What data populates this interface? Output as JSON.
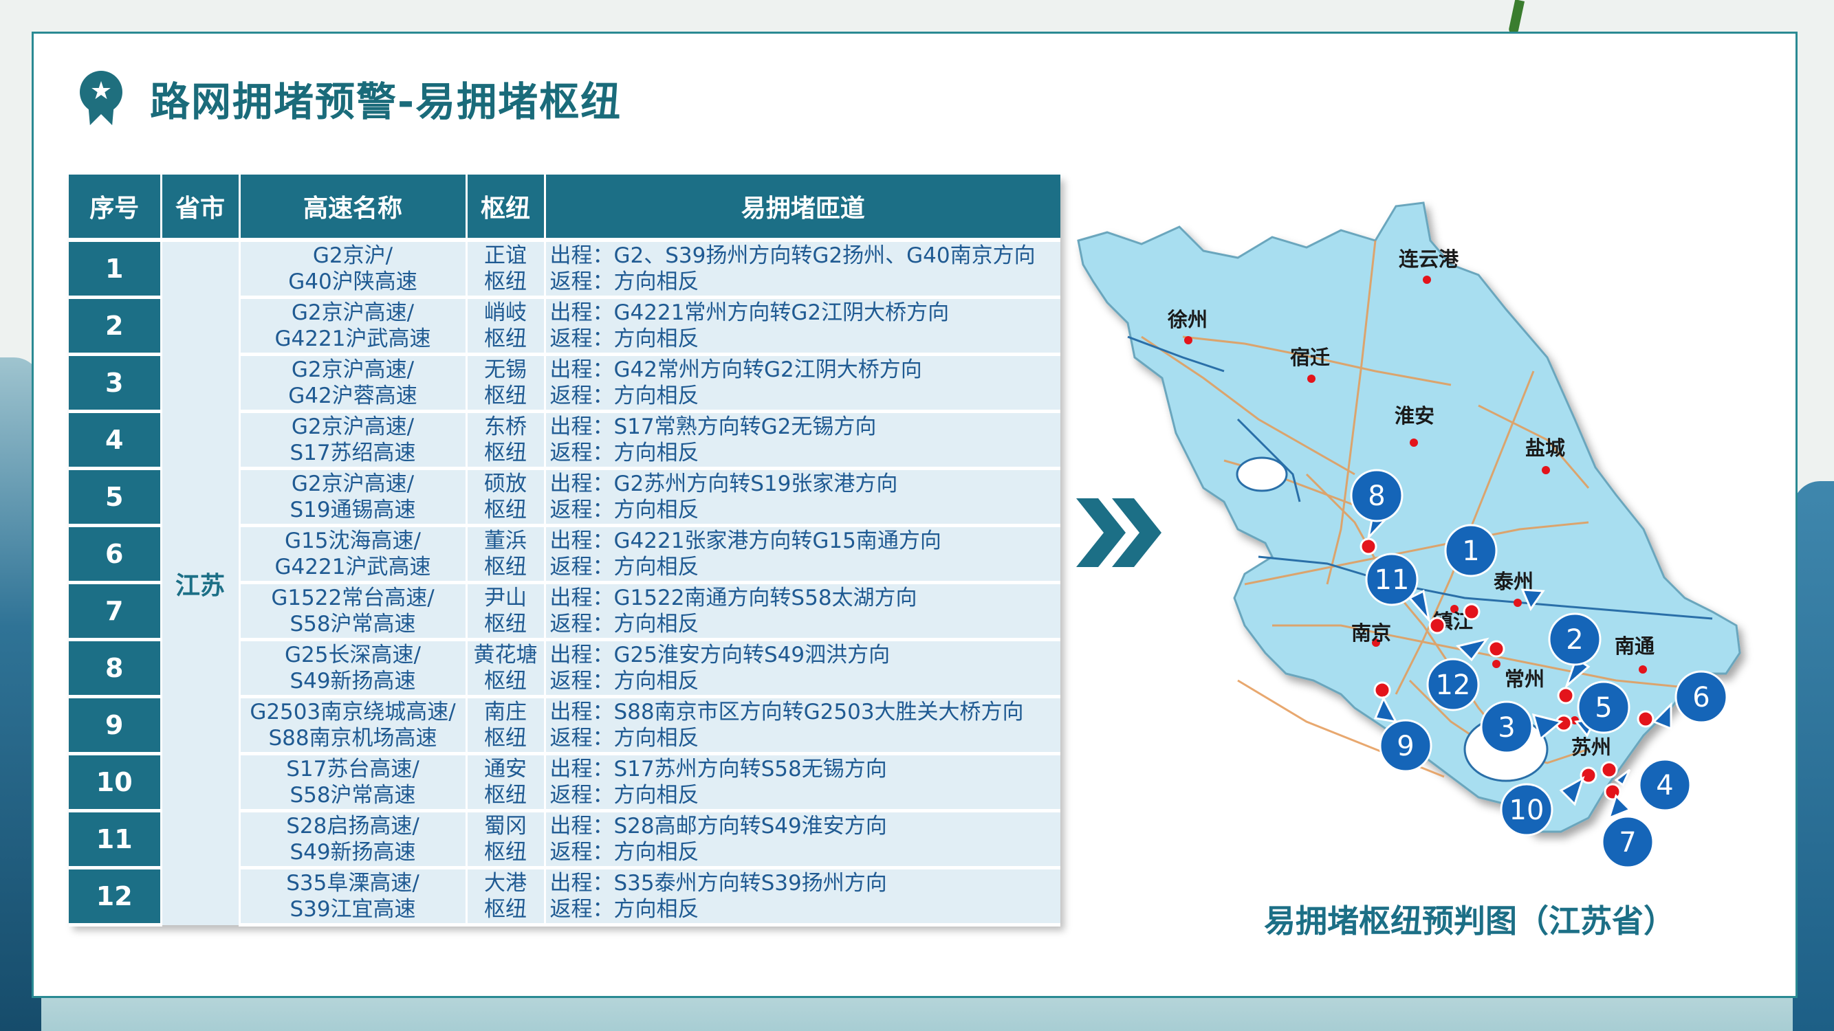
{
  "title": "路网拥堵预警-易拥堵枢纽",
  "table": {
    "headers": [
      "序号",
      "省市",
      "高速名称",
      "枢纽",
      "易拥堵匝道"
    ],
    "province": "江苏",
    "rows": [
      {
        "seq": "1",
        "hw1": "G2京沪/",
        "hw2": "G40沪陕高速",
        "hub1": "正谊",
        "hub2": "枢纽",
        "out": "出程：G2、S39扬州方向转G2扬州、G40南京方向",
        "back": "返程：方向相反"
      },
      {
        "seq": "2",
        "hw1": "G2京沪高速/",
        "hw2": "G4221沪武高速",
        "hub1": "峭岐",
        "hub2": "枢纽",
        "out": "出程：G4221常州方向转G2江阴大桥方向",
        "back": "返程：方向相反"
      },
      {
        "seq": "3",
        "hw1": "G2京沪高速/",
        "hw2": "G42沪蓉高速",
        "hub1": "无锡",
        "hub2": "枢纽",
        "out": "出程：G42常州方向转G2江阴大桥方向",
        "back": "返程：方向相反"
      },
      {
        "seq": "4",
        "hw1": "G2京沪高速/",
        "hw2": "S17苏绍高速",
        "hub1": "东桥",
        "hub2": "枢纽",
        "out": "出程：S17常熟方向转G2无锡方向",
        "back": "返程：方向相反"
      },
      {
        "seq": "5",
        "hw1": "G2京沪高速/",
        "hw2": "S19通锡高速",
        "hub1": "硕放",
        "hub2": "枢纽",
        "out": "出程：G2苏州方向转S19张家港方向",
        "back": "返程：方向相反"
      },
      {
        "seq": "6",
        "hw1": "G15沈海高速/",
        "hw2": "G4221沪武高速",
        "hub1": "董浜",
        "hub2": "枢纽",
        "out": "出程：G4221张家港方向转G15南通方向",
        "back": "返程：方向相反"
      },
      {
        "seq": "7",
        "hw1": "G1522常台高速/",
        "hw2": "S58沪常高速",
        "hub1": "尹山",
        "hub2": "枢纽",
        "out": "出程：G1522南通方向转S58太湖方向",
        "back": "返程：方向相反"
      },
      {
        "seq": "8",
        "hw1": "G25长深高速/",
        "hw2": "S49新扬高速",
        "hub1": "黄花塘",
        "hub2": "枢纽",
        "out": "出程：G25淮安方向转S49泗洪方向",
        "back": "返程：方向相反"
      },
      {
        "seq": "9",
        "hw1": "G2503南京绕城高速/",
        "hw2": "S88南京机场高速",
        "hub1": "南庄",
        "hub2": "枢纽",
        "out": "出程：S88南京市区方向转G2503大胜关大桥方向",
        "back": "返程：方向相反"
      },
      {
        "seq": "10",
        "hw1": "S17苏台高速/",
        "hw2": "S58沪常高速",
        "hub1": "通安",
        "hub2": "枢纽",
        "out": "出程：S17苏州方向转S58无锡方向",
        "back": "返程：方向相反"
      },
      {
        "seq": "11",
        "hw1": "S28启扬高速/",
        "hw2": "S49新扬高速",
        "hub1": "蜀冈",
        "hub2": "枢纽",
        "out": "出程：S28高邮方向转S49淮安方向",
        "back": "返程：方向相反"
      },
      {
        "seq": "12",
        "hw1": "S35阜溧高速/",
        "hw2": "S39江宜高速",
        "hub1": "大港",
        "hub2": "枢纽",
        "out": "出程：S35泰州方向转S39扬州方向",
        "back": "返程：方向相反"
      }
    ]
  },
  "map": {
    "caption": "易拥堵枢纽预判图（江苏省）",
    "cities": [
      "连云港",
      "徐州",
      "宿迁",
      "淮安",
      "盐城",
      "泰州",
      "镇江",
      "南京",
      "常州",
      "南通",
      "苏州"
    ],
    "markers": [
      "1",
      "2",
      "3",
      "4",
      "5",
      "6",
      "7",
      "8",
      "9",
      "10",
      "11",
      "12"
    ]
  },
  "colors": {
    "accent": "#1c6f86",
    "row_bg": "#e1eef5",
    "marker": "#1565b8",
    "hub_dot": "#e3141b",
    "map_fill": "#a8def0"
  }
}
